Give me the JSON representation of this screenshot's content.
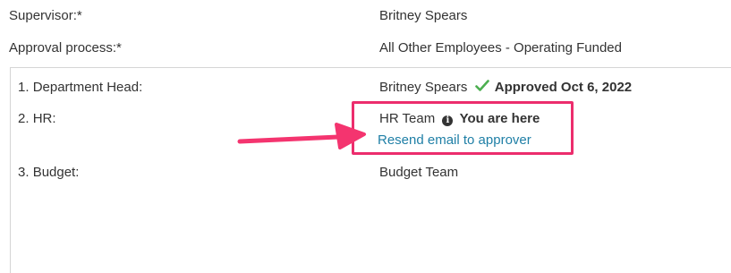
{
  "supervisor": {
    "label": "Supervisor:*",
    "value": "Britney Spears"
  },
  "approval_process": {
    "label": "Approval process:*",
    "value": "All Other Employees - Operating Funded"
  },
  "steps": [
    {
      "number": "1.",
      "label": "Department Head:",
      "approver": "Britney Spears",
      "status_icon": "checkmark-icon",
      "status_text": "Approved Oct 6, 2022"
    },
    {
      "number": "2.",
      "label": "HR:",
      "approver": "HR Team",
      "status_icon": "info-icon",
      "status_text": "You are here",
      "action_link": "Resend email to approver"
    },
    {
      "number": "3.",
      "label": "Budget:",
      "approver": "Budget Team"
    }
  ],
  "colors": {
    "highlight": "#ec2d6d",
    "link": "#1f7fa6",
    "check": "#4caf50",
    "border": "#d5d5d5"
  },
  "info_glyph": "i"
}
